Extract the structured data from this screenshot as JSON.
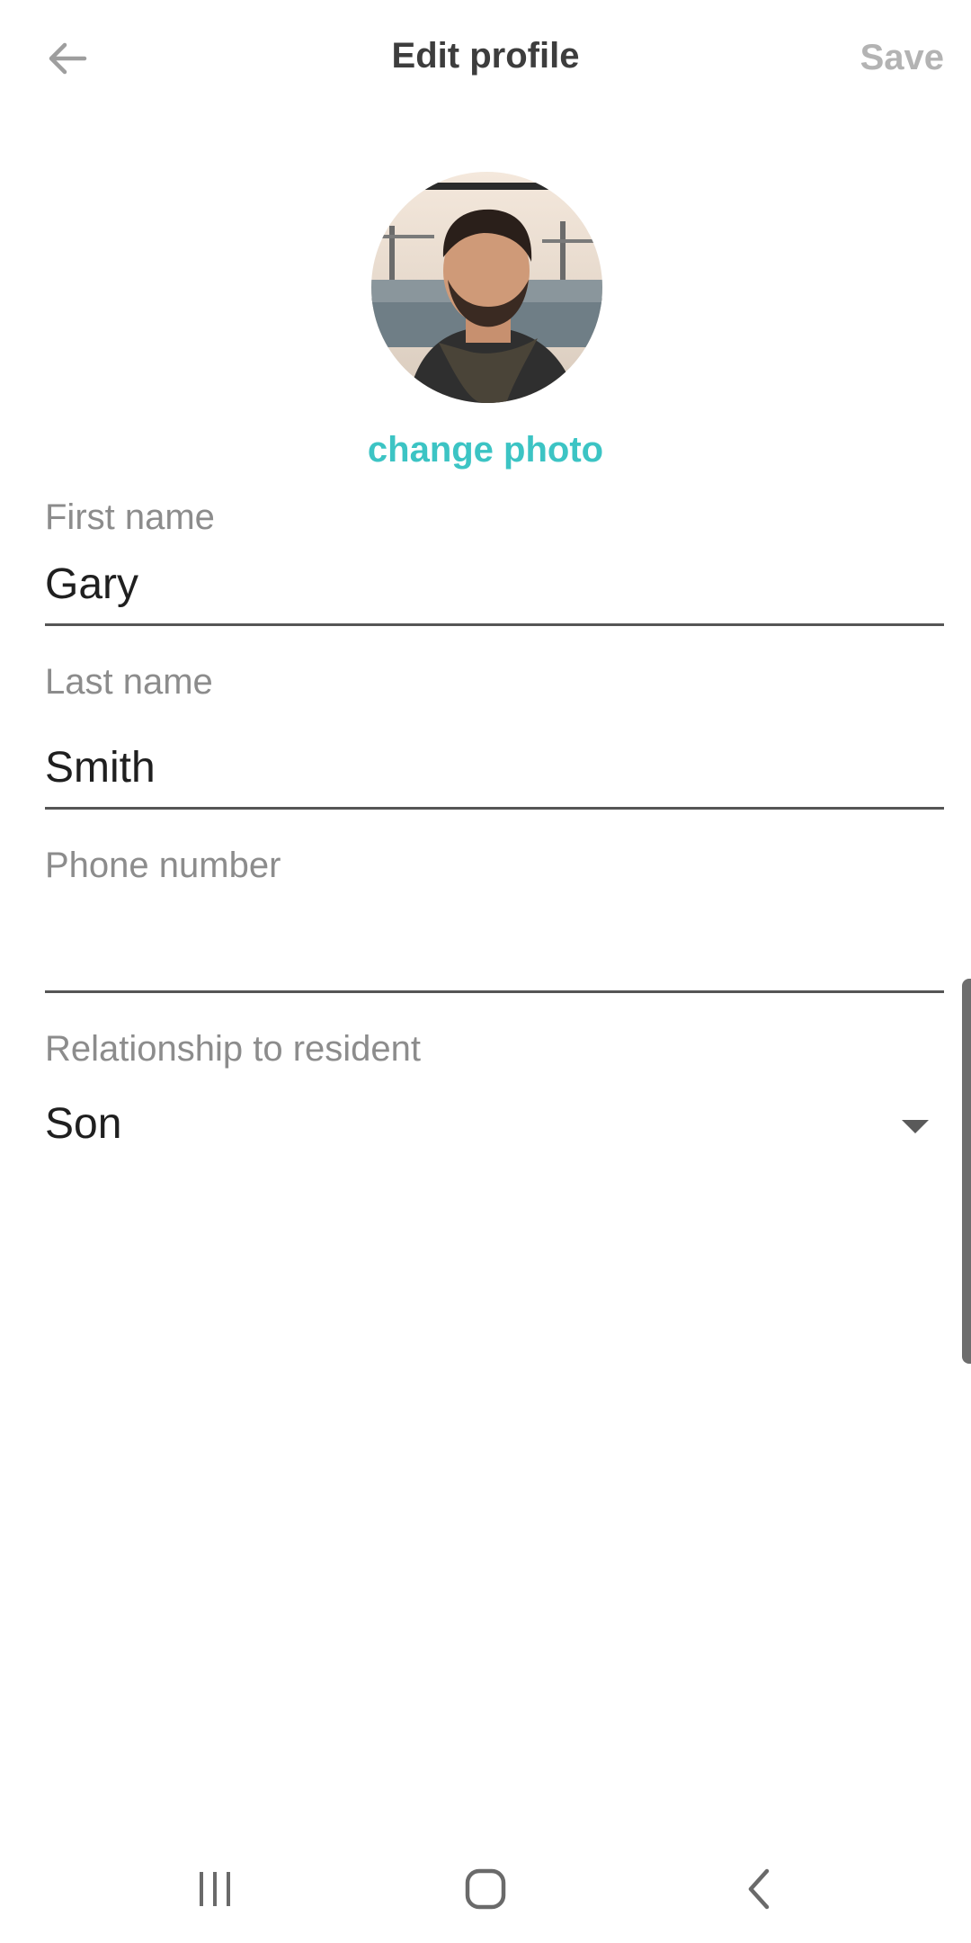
{
  "header": {
    "title": "Edit profile",
    "save_label": "Save",
    "back_icon": "arrow-left-icon"
  },
  "avatar": {
    "change_photo_label": "change photo"
  },
  "form": {
    "first_name": {
      "label": "First name",
      "value": "Gary"
    },
    "last_name": {
      "label": "Last name",
      "value": "Smith"
    },
    "phone": {
      "label": "Phone number",
      "value": ""
    },
    "relationship": {
      "label": "Relationship to resident",
      "value": "Son"
    }
  },
  "colors": {
    "accent": "#3cc4c4",
    "title": "#3d3d3d",
    "label": "#8c8c8c",
    "disabled": "#b3b3b3"
  },
  "navbar": {
    "recents_icon": "recents-icon",
    "home_icon": "home-icon",
    "back_icon": "nav-back-icon"
  }
}
